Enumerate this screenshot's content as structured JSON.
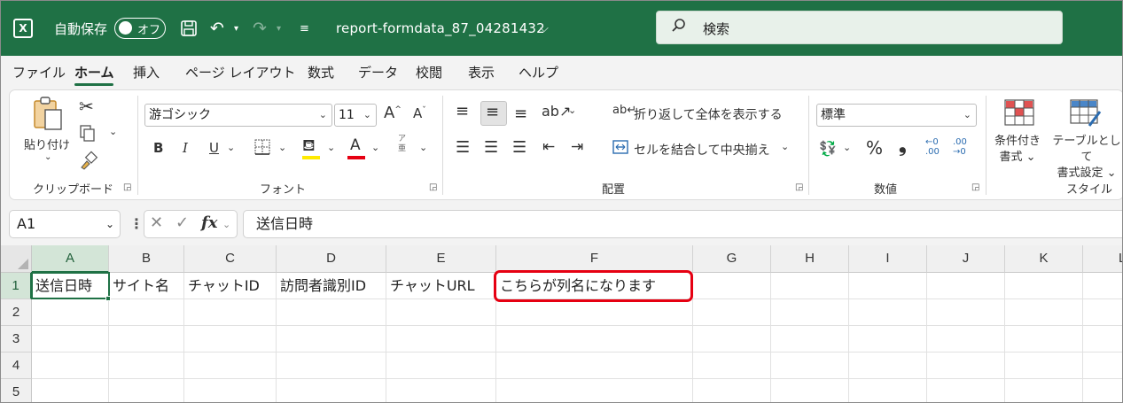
{
  "titlebar": {
    "autosave_label": "自動保存",
    "toggle_text": "オフ",
    "filename": "report-formdata_87_04281432",
    "search_placeholder": "検索",
    "bg_color": "#1f7145"
  },
  "tabs": [
    "ファイル",
    "ホーム",
    "挿入",
    "ページ レイアウト",
    "数式",
    "データ",
    "校閲",
    "表示",
    "ヘルプ"
  ],
  "active_tab": "ホーム",
  "ribbon": {
    "clipboard": {
      "paste_label": "貼り付け",
      "group_label": "クリップボード"
    },
    "font": {
      "font_name": "游ゴシック",
      "font_size": "11",
      "bold": "B",
      "italic": "I",
      "underline": "U",
      "font_color_glyph": "A",
      "phonetic_top": "ア",
      "phonetic_bottom": "亜",
      "group_label": "フォント"
    },
    "alignment": {
      "wrap_text": "折り返して全体を表示する",
      "merge_center": "セルを結合して中央揃え",
      "group_label": "配置"
    },
    "number": {
      "format": "標準",
      "percent": "%",
      "comma": "❟",
      "group_label": "数値"
    },
    "styles": {
      "conditional_line1": "条件付き",
      "conditional_line2": "書式",
      "table_line1": "テーブルとして",
      "table_line2": "書式設定",
      "group_label": "スタイル"
    }
  },
  "formula_bar": {
    "name_box": "A1",
    "fx": "fx",
    "content": "送信日時"
  },
  "sheet": {
    "columns": [
      "A",
      "B",
      "C",
      "D",
      "E",
      "F",
      "G",
      "H",
      "I",
      "J",
      "K",
      "L"
    ],
    "rows": [
      "1",
      "2",
      "3",
      "4",
      "5"
    ],
    "row1": [
      "送信日時",
      "サイト名",
      "チャットID",
      "訪問者識別ID",
      "チャットURL",
      "こちらが列名になります"
    ]
  },
  "annotation_color": "#e60012"
}
